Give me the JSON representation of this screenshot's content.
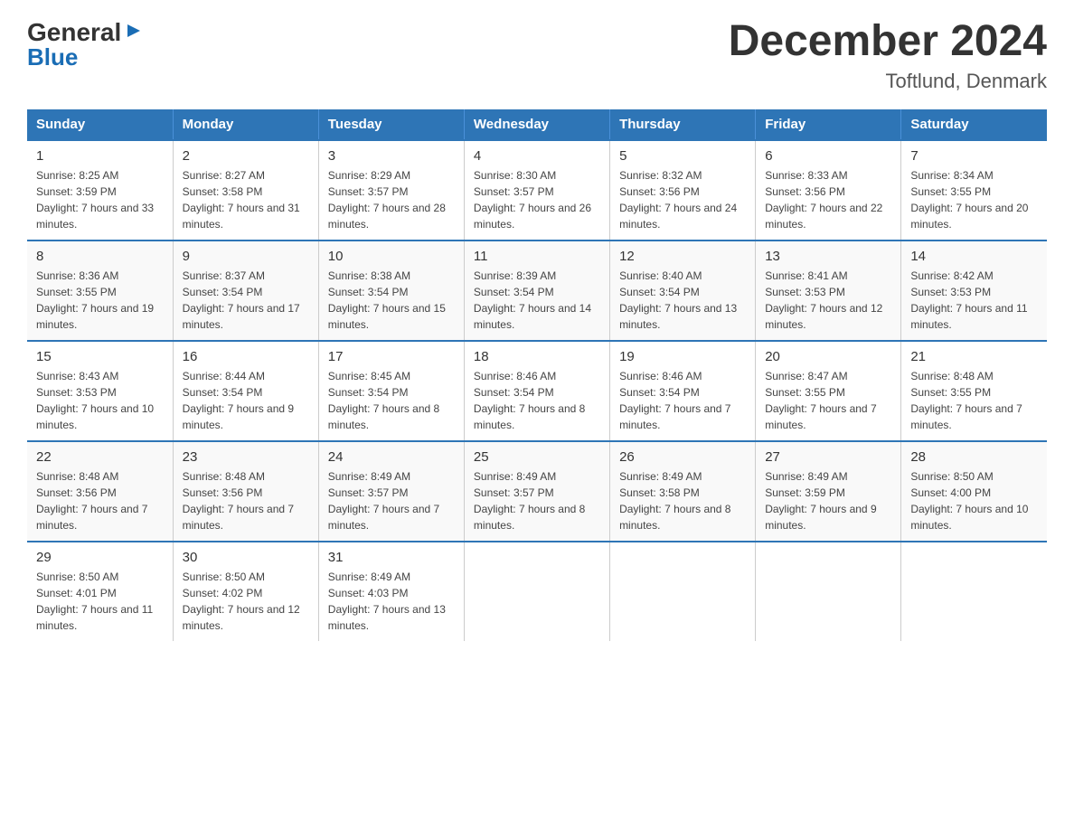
{
  "logo": {
    "general": "General",
    "arrow_char": "▶",
    "blue": "Blue"
  },
  "header": {
    "title": "December 2024",
    "subtitle": "Toftlund, Denmark"
  },
  "days_of_week": [
    "Sunday",
    "Monday",
    "Tuesday",
    "Wednesday",
    "Thursday",
    "Friday",
    "Saturday"
  ],
  "weeks": [
    [
      {
        "day": "1",
        "sunrise": "8:25 AM",
        "sunset": "3:59 PM",
        "daylight": "7 hours and 33 minutes."
      },
      {
        "day": "2",
        "sunrise": "8:27 AM",
        "sunset": "3:58 PM",
        "daylight": "7 hours and 31 minutes."
      },
      {
        "day": "3",
        "sunrise": "8:29 AM",
        "sunset": "3:57 PM",
        "daylight": "7 hours and 28 minutes."
      },
      {
        "day": "4",
        "sunrise": "8:30 AM",
        "sunset": "3:57 PM",
        "daylight": "7 hours and 26 minutes."
      },
      {
        "day": "5",
        "sunrise": "8:32 AM",
        "sunset": "3:56 PM",
        "daylight": "7 hours and 24 minutes."
      },
      {
        "day": "6",
        "sunrise": "8:33 AM",
        "sunset": "3:56 PM",
        "daylight": "7 hours and 22 minutes."
      },
      {
        "day": "7",
        "sunrise": "8:34 AM",
        "sunset": "3:55 PM",
        "daylight": "7 hours and 20 minutes."
      }
    ],
    [
      {
        "day": "8",
        "sunrise": "8:36 AM",
        "sunset": "3:55 PM",
        "daylight": "7 hours and 19 minutes."
      },
      {
        "day": "9",
        "sunrise": "8:37 AM",
        "sunset": "3:54 PM",
        "daylight": "7 hours and 17 minutes."
      },
      {
        "day": "10",
        "sunrise": "8:38 AM",
        "sunset": "3:54 PM",
        "daylight": "7 hours and 15 minutes."
      },
      {
        "day": "11",
        "sunrise": "8:39 AM",
        "sunset": "3:54 PM",
        "daylight": "7 hours and 14 minutes."
      },
      {
        "day": "12",
        "sunrise": "8:40 AM",
        "sunset": "3:54 PM",
        "daylight": "7 hours and 13 minutes."
      },
      {
        "day": "13",
        "sunrise": "8:41 AM",
        "sunset": "3:53 PM",
        "daylight": "7 hours and 12 minutes."
      },
      {
        "day": "14",
        "sunrise": "8:42 AM",
        "sunset": "3:53 PM",
        "daylight": "7 hours and 11 minutes."
      }
    ],
    [
      {
        "day": "15",
        "sunrise": "8:43 AM",
        "sunset": "3:53 PM",
        "daylight": "7 hours and 10 minutes."
      },
      {
        "day": "16",
        "sunrise": "8:44 AM",
        "sunset": "3:54 PM",
        "daylight": "7 hours and 9 minutes."
      },
      {
        "day": "17",
        "sunrise": "8:45 AM",
        "sunset": "3:54 PM",
        "daylight": "7 hours and 8 minutes."
      },
      {
        "day": "18",
        "sunrise": "8:46 AM",
        "sunset": "3:54 PM",
        "daylight": "7 hours and 8 minutes."
      },
      {
        "day": "19",
        "sunrise": "8:46 AM",
        "sunset": "3:54 PM",
        "daylight": "7 hours and 7 minutes."
      },
      {
        "day": "20",
        "sunrise": "8:47 AM",
        "sunset": "3:55 PM",
        "daylight": "7 hours and 7 minutes."
      },
      {
        "day": "21",
        "sunrise": "8:48 AM",
        "sunset": "3:55 PM",
        "daylight": "7 hours and 7 minutes."
      }
    ],
    [
      {
        "day": "22",
        "sunrise": "8:48 AM",
        "sunset": "3:56 PM",
        "daylight": "7 hours and 7 minutes."
      },
      {
        "day": "23",
        "sunrise": "8:48 AM",
        "sunset": "3:56 PM",
        "daylight": "7 hours and 7 minutes."
      },
      {
        "day": "24",
        "sunrise": "8:49 AM",
        "sunset": "3:57 PM",
        "daylight": "7 hours and 7 minutes."
      },
      {
        "day": "25",
        "sunrise": "8:49 AM",
        "sunset": "3:57 PM",
        "daylight": "7 hours and 8 minutes."
      },
      {
        "day": "26",
        "sunrise": "8:49 AM",
        "sunset": "3:58 PM",
        "daylight": "7 hours and 8 minutes."
      },
      {
        "day": "27",
        "sunrise": "8:49 AM",
        "sunset": "3:59 PM",
        "daylight": "7 hours and 9 minutes."
      },
      {
        "day": "28",
        "sunrise": "8:50 AM",
        "sunset": "4:00 PM",
        "daylight": "7 hours and 10 minutes."
      }
    ],
    [
      {
        "day": "29",
        "sunrise": "8:50 AM",
        "sunset": "4:01 PM",
        "daylight": "7 hours and 11 minutes."
      },
      {
        "day": "30",
        "sunrise": "8:50 AM",
        "sunset": "4:02 PM",
        "daylight": "7 hours and 12 minutes."
      },
      {
        "day": "31",
        "sunrise": "8:49 AM",
        "sunset": "4:03 PM",
        "daylight": "7 hours and 13 minutes."
      },
      null,
      null,
      null,
      null
    ]
  ]
}
